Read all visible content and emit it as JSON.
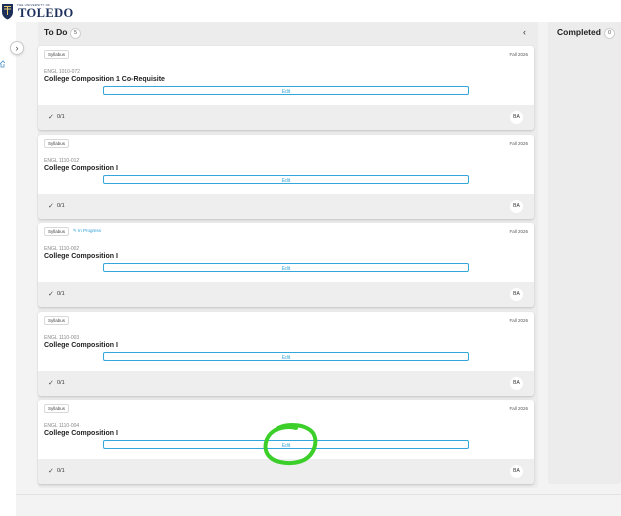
{
  "header": {
    "university_small": "THE UNIVERSITY OF",
    "university_name": "TOLEDO",
    "brand_color": "#1c2f5a"
  },
  "columns": {
    "todo": {
      "title": "To Do",
      "count": "5"
    },
    "completed": {
      "title": "Completed",
      "count": "0"
    }
  },
  "cards": [
    {
      "tag": "Syllabus",
      "status": "",
      "term": "Fall 2026",
      "code": "ENGL 1010-072",
      "title": "College Composition 1 Co-Requisite",
      "edit_label": "Edit",
      "score": "0/1",
      "avatar": "BA"
    },
    {
      "tag": "Syllabus",
      "status": "",
      "term": "Fall 2026",
      "code": "ENGL 1110-012",
      "title": "College Composition I",
      "edit_label": "Edit",
      "score": "0/1",
      "avatar": "BA"
    },
    {
      "tag": "Syllabus",
      "status": "✎ In Progress",
      "term": "Fall 2026",
      "code": "ENGL 1110-002",
      "title": "College Composition I",
      "edit_label": "Edit",
      "score": "0/1",
      "avatar": "BA"
    },
    {
      "tag": "Syllabus",
      "status": "",
      "term": "Fall 2026",
      "code": "ENGL 1110-003",
      "title": "College Composition I",
      "edit_label": "Edit",
      "score": "0/1",
      "avatar": "BA"
    },
    {
      "tag": "Syllabus",
      "status": "",
      "term": "Fall 2026",
      "code": "ENGL 1110-004",
      "title": "College Composition I",
      "edit_label": "Edit",
      "score": "0/1",
      "avatar": "BA"
    }
  ],
  "colors": {
    "accent": "#35a6dc",
    "annotation": "#3ccf2a"
  },
  "icons": {
    "expand": "chevron-right-icon",
    "collapse": "chevron-left-icon",
    "check": "check-icon",
    "in_progress": "pencil-icon"
  }
}
